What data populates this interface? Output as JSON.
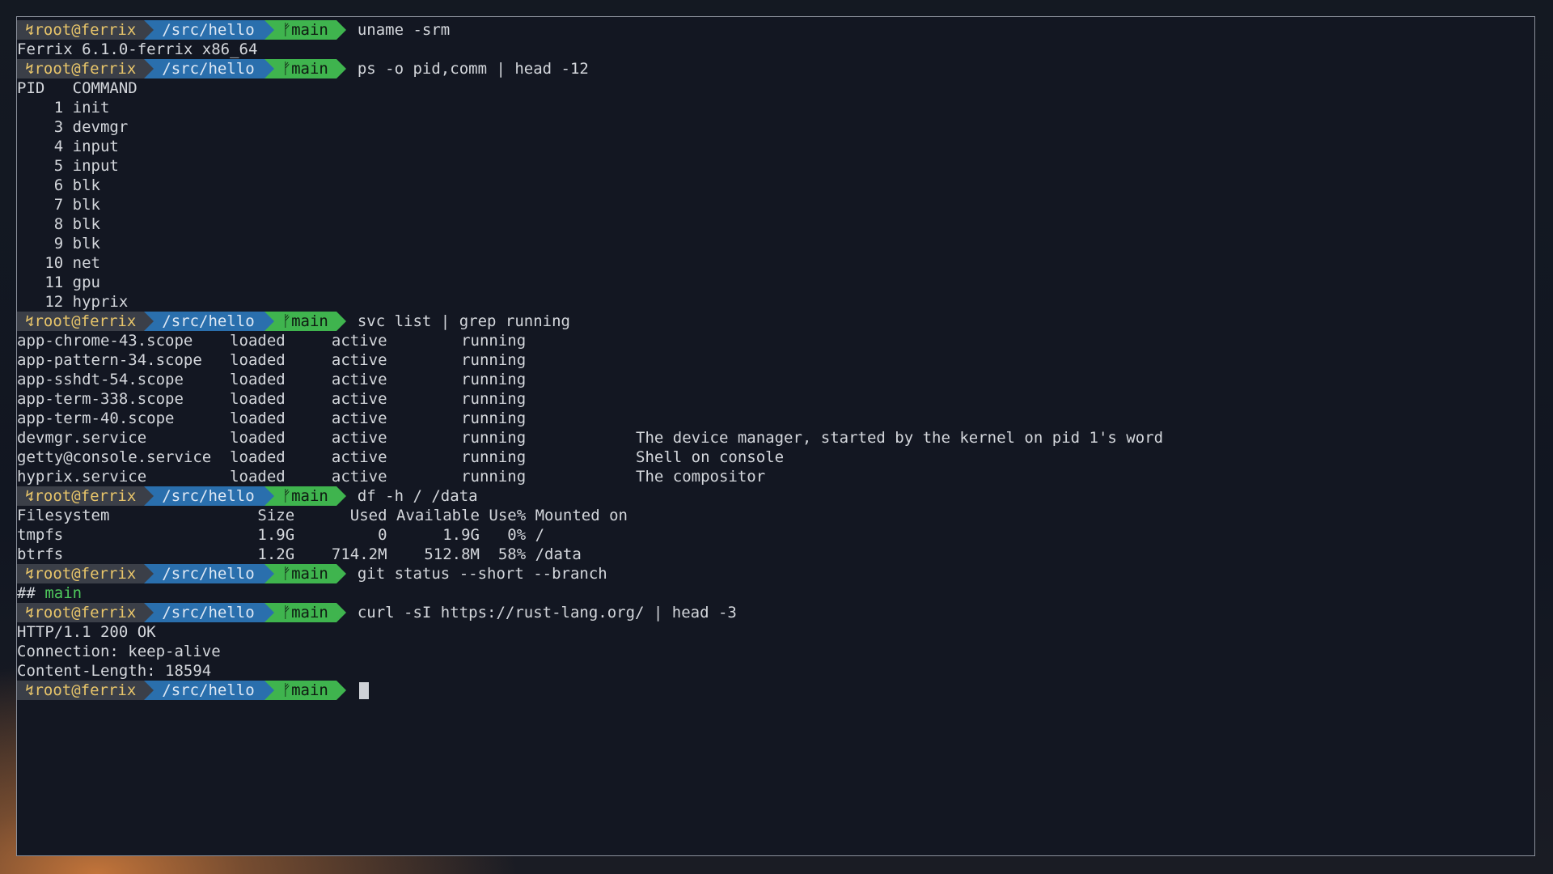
{
  "prompt": {
    "user_glyph": "↯",
    "user": "root@ferrix",
    "dir": "/src/hello",
    "git_glyph": "ᚠ",
    "branch": "main"
  },
  "blocks": [
    {
      "command": "uname -srm",
      "output": [
        "Ferrix 6.1.0-ferrix x86_64"
      ]
    },
    {
      "command": "ps -o pid,comm | head -12",
      "output": [
        "PID   COMMAND",
        "    1 init",
        "    3 devmgr",
        "    4 input",
        "    5 input",
        "    6 blk",
        "    7 blk",
        "    8 blk",
        "    9 blk",
        "   10 net",
        "   11 gpu",
        "   12 hyprix"
      ]
    },
    {
      "command": "svc list | grep running",
      "output": [
        "app-chrome-43.scope    loaded     active        running",
        "app-pattern-34.scope   loaded     active        running",
        "app-sshdt-54.scope     loaded     active        running",
        "app-term-338.scope     loaded     active        running",
        "app-term-40.scope      loaded     active        running",
        "devmgr.service         loaded     active        running",
        "getty@console.service  loaded     active        running",
        "hyprix.service         loaded     active        running"
      ],
      "descriptions": [
        "",
        "",
        "",
        "",
        "",
        "The device manager, started by the kernel on pid 1's word",
        "Shell on console",
        "The compositor"
      ]
    },
    {
      "command": "df -h / /data",
      "output": [
        "Filesystem                Size      Used Available Use% Mounted on",
        "tmpfs                     1.9G         0      1.9G   0% /",
        "btrfs                     1.2G    714.2M    512.8M  58% /data"
      ]
    },
    {
      "command": "git status --short --branch",
      "output_git": {
        "prefix": "## ",
        "branch": "main"
      }
    },
    {
      "command": "curl -sI https://rust-lang.org/ | head -3",
      "output": [
        "HTTP/1.1 200 OK",
        "Connection: keep-alive",
        "Content-Length: 18594"
      ]
    }
  ],
  "colors": {
    "user_bg": "#3b3f48",
    "user_fg": "#e8c56a",
    "dir_bg": "#2a6fad",
    "git_bg": "#3fb44e",
    "terminal_bg": "#131722"
  }
}
